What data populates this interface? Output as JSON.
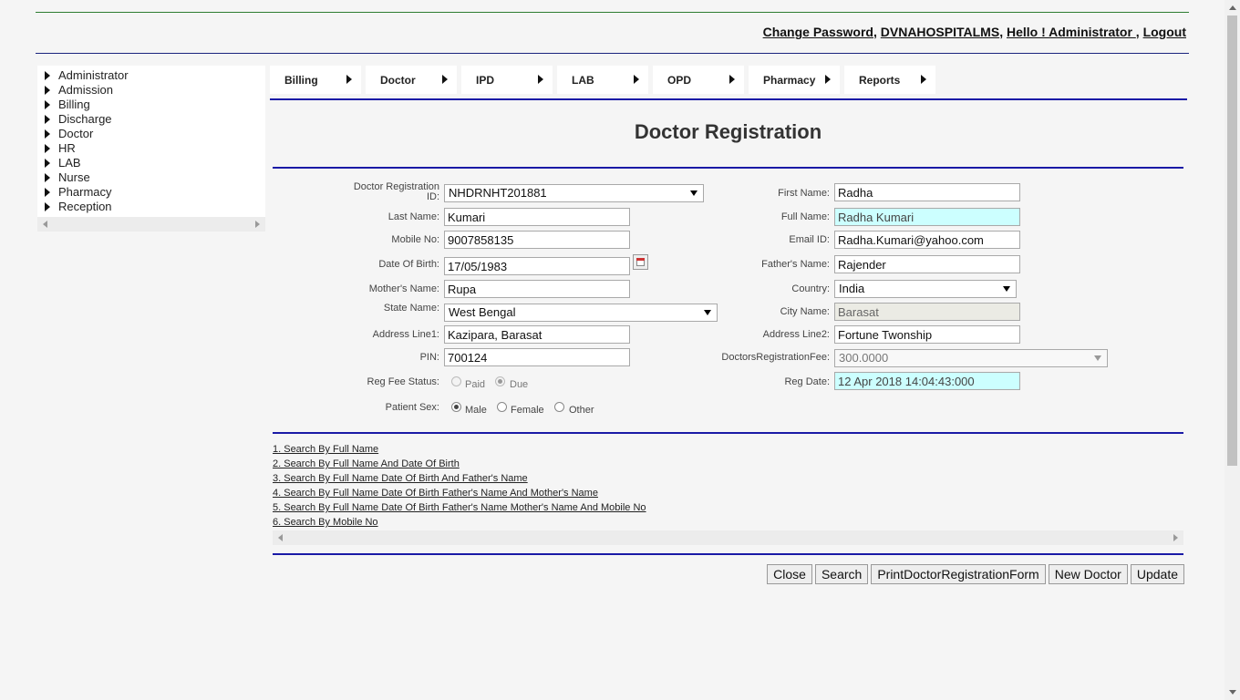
{
  "header": {
    "change_password": "Change Password",
    "hospital": "DVNAHOSPITALMS",
    "greeting": "Hello ! Administrator ",
    "logout": "Logout"
  },
  "sidebar": {
    "items": [
      "Administrator",
      "Admission",
      "Billing",
      "Discharge",
      "Doctor",
      "HR",
      "LAB",
      "Nurse",
      "Pharmacy",
      "Reception"
    ]
  },
  "menu": {
    "items": [
      "Billing",
      "Doctor",
      "IPD",
      "LAB",
      "OPD",
      "Pharmacy",
      "Reports"
    ]
  },
  "page": {
    "title": "Doctor Registration"
  },
  "form": {
    "reg_id": {
      "label_line1": "Doctor Registration",
      "label_line2": "ID:",
      "value": "NHDRNHT201881"
    },
    "first_name": {
      "label": "First Name:",
      "value": "Radha"
    },
    "last_name": {
      "label": "Last Name:",
      "value": "Kumari"
    },
    "full_name": {
      "label": "Full Name:",
      "value": "Radha Kumari"
    },
    "mobile": {
      "label": "Mobile No:",
      "value": "9007858135"
    },
    "email": {
      "label": "Email ID:",
      "value": "Radha.Kumari@yahoo.com"
    },
    "dob": {
      "label": "Date Of Birth:",
      "value": "17/05/1983"
    },
    "father": {
      "label": "Father's Name:",
      "value": "Rajender"
    },
    "mother": {
      "label": "Mother's Name:",
      "value": "Rupa"
    },
    "country": {
      "label": "Country:",
      "value": "India"
    },
    "state": {
      "label": "State Name:",
      "value": "West Bengal"
    },
    "city": {
      "label": "City Name:",
      "value": "Barasat"
    },
    "address1": {
      "label": "Address Line1:",
      "value": "Kazipara, Barasat"
    },
    "address2": {
      "label": "Address Line2:",
      "value": "Fortune Twonship"
    },
    "pin": {
      "label": "PIN:",
      "value": "700124"
    },
    "reg_fee": {
      "label": "DoctorsRegistrationFee:",
      "value": "300.0000"
    },
    "fee_status": {
      "label": "Reg Fee Status:",
      "options": [
        "Paid",
        "Due"
      ],
      "selected": "Due"
    },
    "reg_date": {
      "label": "Reg Date:",
      "value": "12 Apr 2018 14:04:43:000"
    },
    "sex": {
      "label": "Patient Sex:",
      "options": [
        "Male",
        "Female",
        "Other"
      ],
      "selected": "Male"
    }
  },
  "search_links": [
    "1. Search By Full Name",
    "2. Search By Full Name And Date Of Birth",
    "3. Search By Full Name Date Of Birth And Father's Name",
    "4. Search By Full Name Date Of Birth Father's Name And Mother's Name",
    "5. Search By Full Name Date Of Birth Father's Name Mother's Name And Mobile No",
    "6. Search By Mobile No"
  ],
  "buttons": {
    "close": "Close",
    "search": "Search",
    "print": "PrintDoctorRegistrationForm",
    "new_doctor": "New Doctor",
    "update": "Update"
  },
  "colors": {
    "accent_line": "#1a1aa6",
    "top_line": "#2e7d32",
    "readonly_field": "#ccffff"
  }
}
